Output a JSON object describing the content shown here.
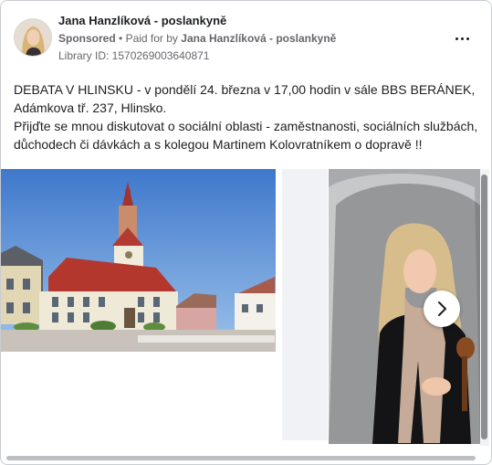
{
  "advertiser": {
    "name": "Jana Hanzlíková - poslankyně",
    "sponsored_label": "Sponsored",
    "separator": "•",
    "paid_for_prefix": "Paid for by",
    "paid_for_name": "Jana Hanzlíková - poslankyně",
    "library_id": "Library ID: 1570269003640871"
  },
  "post": {
    "lines": [
      "DEBATA V HLINSKU - v pondělí 24. března v 17,00 hodin v sále BBS BERÁNEK,",
      "Adámkova tř. 237, Hlinsko.",
      "Přijďte se mnou diskutovat o sociální oblasti - zaměstnanosti, sociálních službách,",
      "důchodech či dávkách a s kolegou Martinem Kolovratníkem o dopravě !!"
    ]
  },
  "carousel": {
    "images": [
      "town-hall-photo",
      "portrait-photo"
    ],
    "next_icon": "chevron-right-icon"
  },
  "colors": {
    "text_primary": "#1c1e21",
    "text_secondary": "#65676b",
    "border": "#c9ccd1",
    "sky": "#5f8fd0"
  }
}
